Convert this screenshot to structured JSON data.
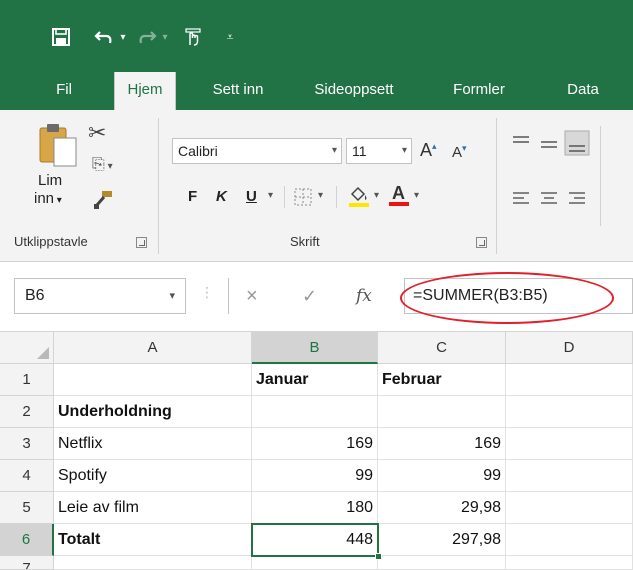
{
  "qat": {
    "save_icon": "save-icon",
    "undo_icon": "undo-icon",
    "redo_icon": "redo-icon",
    "touch_icon": "touch-mode-icon",
    "customize_icon": "customize-qat-icon"
  },
  "tabs": [
    {
      "label": "Fil"
    },
    {
      "label": "Hjem"
    },
    {
      "label": "Sett inn"
    },
    {
      "label": "Sideoppsett"
    },
    {
      "label": "Formler"
    },
    {
      "label": "Data"
    }
  ],
  "ribbon": {
    "clipboard": {
      "paste_label_1": "Lim",
      "paste_label_2": "inn",
      "group_label": "Utklippstavle"
    },
    "font": {
      "font_name": "Calibri",
      "font_size": "11",
      "bold": "F",
      "italic": "K",
      "underline": "U",
      "group_label": "Skrift"
    }
  },
  "formula_bar": {
    "name_box": "B6",
    "cancel": "×",
    "enter": "✓",
    "fx": "fx",
    "formula": "=SUMMER(B3:B5)"
  },
  "sheet": {
    "columns": [
      "A",
      "B",
      "C",
      "D"
    ],
    "rows": [
      "1",
      "2",
      "3",
      "4",
      "5",
      "6",
      "7"
    ],
    "cells": {
      "B1": "Januar",
      "C1": "Februar",
      "A2": "Underholdning",
      "A3": "Netflix",
      "B3": "169",
      "C3": "169",
      "A4": "Spotify",
      "B4": "99",
      "C4": "99",
      "A5": "Leie av film",
      "B5": "180",
      "C5": "29,98",
      "A6": "Totalt",
      "B6": "448",
      "C6": "297,98"
    }
  },
  "colors": {
    "accent": "#217346",
    "highlight_oval": "#e0202a"
  }
}
